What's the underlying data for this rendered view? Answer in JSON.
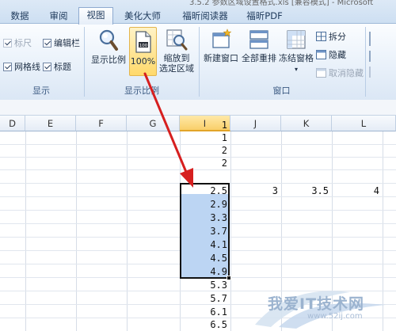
{
  "window": {
    "title_fragment": "3.5.2 参数区域设置格式.xls [兼容模式] - Microsoft"
  },
  "tabs": [
    {
      "label": "数据"
    },
    {
      "label": "审阅"
    },
    {
      "label": "视图",
      "active": true
    },
    {
      "label": "美化大师"
    },
    {
      "label": "福昕阅读器"
    },
    {
      "label": "福昕PDF"
    }
  ],
  "show_group": {
    "label": "显示",
    "items": [
      {
        "label": "标尺",
        "checked": true,
        "disabled": true
      },
      {
        "label": "编辑栏",
        "checked": true
      },
      {
        "label": "网格线",
        "checked": true
      },
      {
        "label": "标题",
        "checked": true
      }
    ]
  },
  "zoom_group": {
    "label": "显示比例",
    "buttons": [
      {
        "label": "显示比例"
      },
      {
        "label": "100%",
        "active": true
      },
      {
        "label": "缩放到",
        "label2": "选定区域"
      }
    ]
  },
  "window_group": {
    "label": "窗口",
    "buttons": [
      {
        "label": "新建窗口"
      },
      {
        "label": "全部重排"
      },
      {
        "label": "冻结窗格"
      }
    ],
    "small_buttons": [
      {
        "label": "拆分"
      },
      {
        "label": "隐藏"
      },
      {
        "label": "取消隐藏",
        "disabled": true
      }
    ]
  },
  "columns": [
    "D",
    "E",
    "F",
    "G",
    "I",
    "J",
    "K",
    "L"
  ],
  "column_i_values": [
    "1",
    "1",
    "2",
    "2",
    "2.5",
    "2.9",
    "3.3",
    "3.7",
    "4.1",
    "4.5",
    "4.9",
    "5.3",
    "5.7",
    "6.1",
    "6.5"
  ],
  "row_values": {
    "J": "3",
    "K": "3.5",
    "L": "4"
  },
  "selection": {
    "column": "I",
    "start_value": "2.5",
    "end_value": "4.9"
  },
  "watermark": {
    "text": "我爱IT技术网",
    "url": "www.52ij.com"
  },
  "colors": {
    "selection": "#bcd5f3",
    "arrow": "#d61f1f",
    "active_button": "#ffd96b"
  },
  "icons": [
    "magnifier-icon",
    "page-100-icon",
    "zoom-selection-icon",
    "new-window-icon",
    "arrange-all-icon",
    "freeze-panes-icon",
    "split-icon",
    "hide-icon",
    "unhide-icon"
  ]
}
